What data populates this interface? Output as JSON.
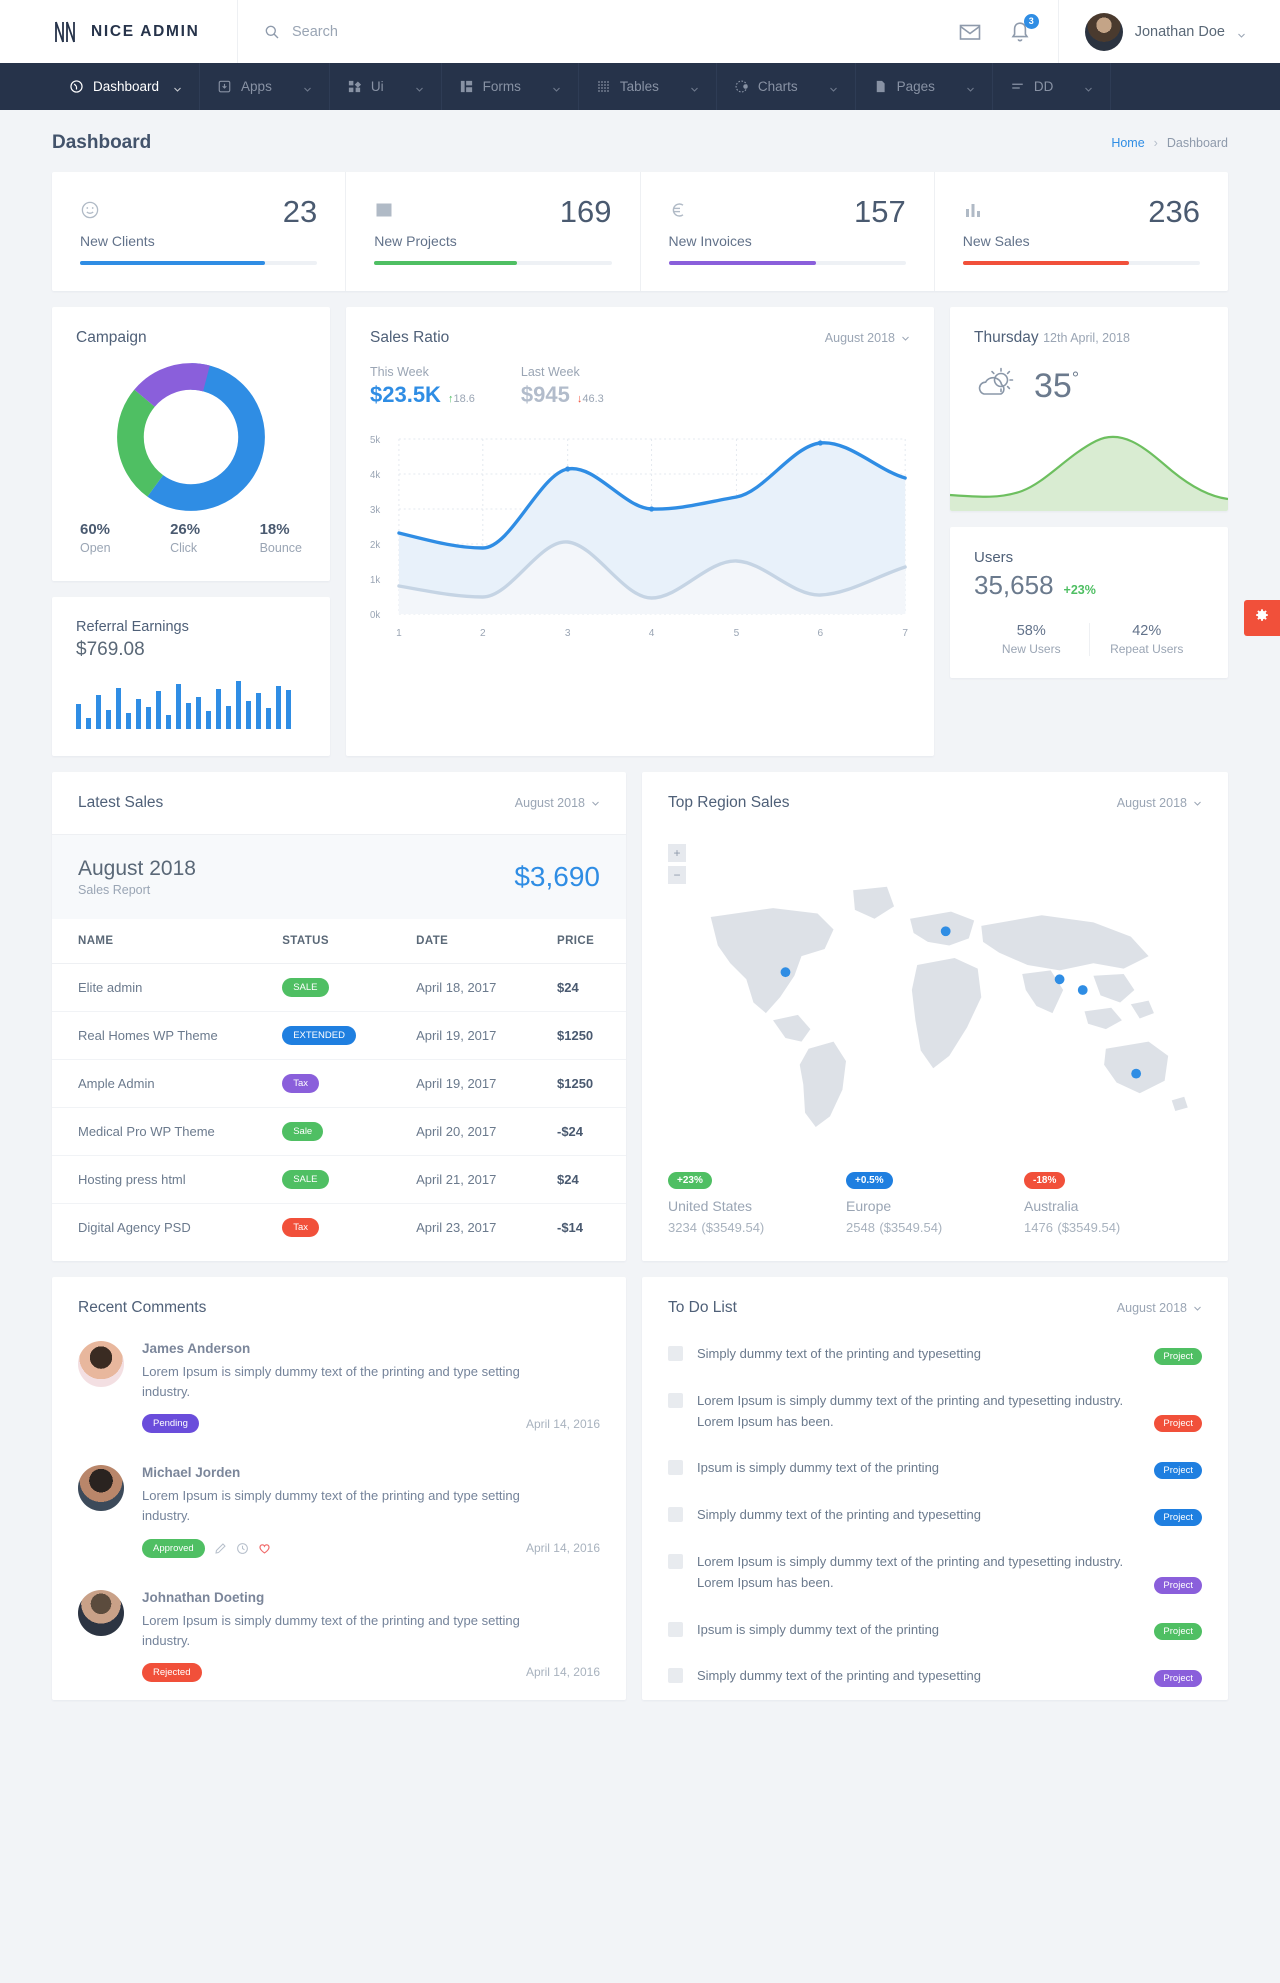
{
  "brand": {
    "name": "NICE ADMIN",
    "icon": "brand-n-icon"
  },
  "search": {
    "placeholder": "Search",
    "value": ""
  },
  "topbar": {
    "mail_icon": "envelope-icon",
    "bell_icon": "bell-icon",
    "notification_count": "3",
    "user_name": "Jonathan Doe"
  },
  "nav": [
    {
      "label": "Dashboard",
      "icon": "speedometer-icon",
      "active": true
    },
    {
      "label": "Apps",
      "icon": "app-box-icon",
      "active": false
    },
    {
      "label": "Ui",
      "icon": "grid-blocks-icon",
      "active": false
    },
    {
      "label": "Forms",
      "icon": "form-columns-icon",
      "active": false
    },
    {
      "label": "Tables",
      "icon": "table-dots-icon",
      "active": false
    },
    {
      "label": "Charts",
      "icon": "target-icon",
      "active": false
    },
    {
      "label": "Pages",
      "icon": "page-icon",
      "active": false
    },
    {
      "label": "DD",
      "icon": "menu-lines-icon",
      "active": false
    }
  ],
  "page": {
    "title": "Dashboard",
    "breadcrumb_home": "Home",
    "breadcrumb_sep": "›",
    "breadcrumb_current": "Dashboard"
  },
  "stats": [
    {
      "label": "New Clients",
      "value": "23",
      "icon": "smiley-icon",
      "color": "#2f8de4",
      "fill": 78
    },
    {
      "label": "New Projects",
      "value": "169",
      "icon": "image-icon",
      "color": "#4fbf63",
      "fill": 60
    },
    {
      "label": "New Invoices",
      "value": "157",
      "icon": "euro-icon",
      "color": "#8a5fdb",
      "fill": 62
    },
    {
      "label": "New Sales",
      "value": "236",
      "icon": "bar-chart-icon",
      "color": "#f1503a",
      "fill": 70
    }
  ],
  "campaign": {
    "title": "Campaign",
    "metrics": [
      {
        "value": "60%",
        "label": "Open",
        "color": "#2f8de4"
      },
      {
        "value": "26%",
        "label": "Click",
        "color": "#4fbf63"
      },
      {
        "value": "18%",
        "label": "Bounce",
        "color": "#8a5fdb"
      }
    ]
  },
  "referral": {
    "title": "Referral Earnings",
    "amount": "$769.08"
  },
  "sales_ratio": {
    "title": "Sales Ratio",
    "period": "August 2018",
    "this_week_label": "This Week",
    "this_week_value": "$23.5K",
    "this_week_delta": "18.6",
    "this_week_dir": "↑",
    "last_week_label": "Last Week",
    "last_week_value": "$945",
    "last_week_delta": "46.3",
    "last_week_dir": "↓"
  },
  "weather": {
    "day": "Thursday",
    "date": "12th April, 2018",
    "temperature": "35",
    "degree_symbol": "°",
    "icon": "sun-cloud-icon"
  },
  "users": {
    "title": "Users",
    "count": "35,658",
    "change": "+23%",
    "new_users_value": "58%",
    "new_users_label": "New Users",
    "repeat_users_value": "42%",
    "repeat_users_label": "Repeat Users"
  },
  "latest_sales": {
    "title": "Latest Sales",
    "period": "August 2018",
    "month": "August 2018",
    "subtitle": "Sales Report",
    "total": "$3,690",
    "columns": [
      "NAME",
      "STATUS",
      "DATE",
      "PRICE"
    ],
    "rows": [
      {
        "name": "Elite admin",
        "status": "SALE",
        "status_color": "#4fbf63",
        "date": "April 18, 2017",
        "price": "$24"
      },
      {
        "name": "Real Homes WP Theme",
        "status": "EXTENDED",
        "status_color": "#1f7fe0",
        "date": "April 19, 2017",
        "price": "$1250"
      },
      {
        "name": "Ample Admin",
        "status": "Tax",
        "status_color": "#8a5fdb",
        "date": "April 19, 2017",
        "price": "$1250"
      },
      {
        "name": "Medical Pro WP Theme",
        "status": "Sale",
        "status_color": "#4fbf63",
        "date": "April 20, 2017",
        "price": "-$24"
      },
      {
        "name": "Hosting press html",
        "status": "SALE",
        "status_color": "#4fbf63",
        "date": "April 21, 2017",
        "price": "$24"
      },
      {
        "name": "Digital Agency PSD",
        "status": "Tax",
        "status_color": "#f1503a",
        "date": "April 23, 2017",
        "price": "-$14"
      }
    ]
  },
  "top_region": {
    "title": "Top Region Sales",
    "period": "August 2018",
    "zoom_in": "+",
    "zoom_out": "−",
    "regions": [
      {
        "badge": "+23%",
        "badge_color": "#4fbf63",
        "name": "United States",
        "value": "3234",
        "amount": "($3549.54)"
      },
      {
        "badge": "+0.5%",
        "badge_color": "#1f7fe0",
        "name": "Europe",
        "value": "2548",
        "amount": "($3549.54)"
      },
      {
        "badge": "-18%",
        "badge_color": "#f1503a",
        "name": "Australia",
        "value": "1476",
        "amount": "($3549.54)"
      }
    ]
  },
  "recent_comments": {
    "title": "Recent Comments",
    "items": [
      {
        "name": "James Anderson",
        "text": "Lorem Ipsum is simply dummy text of the printing and type setting industry.",
        "status": "Pending",
        "status_color": "#6a4ddb",
        "date": "April 14, 2016",
        "has_actions": false
      },
      {
        "name": "Michael Jorden",
        "text": "Lorem Ipsum is simply dummy text of the printing and type setting industry.",
        "status": "Approved",
        "status_color": "#4fbf63",
        "date": "April 14, 2016",
        "has_actions": true
      },
      {
        "name": "Johnathan Doeting",
        "text": "Lorem Ipsum is simply dummy text of the printing and type setting industry.",
        "status": "Rejected",
        "status_color": "#f1503a",
        "date": "April 14, 2016",
        "has_actions": false
      }
    ]
  },
  "todo": {
    "title": "To Do List",
    "period": "August 2018",
    "items": [
      {
        "text": "Simply dummy text of the printing and typesetting",
        "tag": "Project",
        "tag_color": "#4fbf63"
      },
      {
        "text": "Lorem Ipsum is simply dummy text of the printing and typesetting industry. Lorem Ipsum has been.",
        "tag": "Project",
        "tag_color": "#f1503a"
      },
      {
        "text": "Ipsum is simply dummy text of the printing",
        "tag": "Project",
        "tag_color": "#1f7fe0"
      },
      {
        "text": "Simply dummy text of the printing and typesetting",
        "tag": "Project",
        "tag_color": "#1f7fe0"
      },
      {
        "text": "Lorem Ipsum is simply dummy text of the printing and typesetting industry. Lorem Ipsum has been.",
        "tag": "Project",
        "tag_color": "#8a5fdb"
      },
      {
        "text": "Ipsum is simply dummy text of the printing",
        "tag": "Project",
        "tag_color": "#4fbf63"
      },
      {
        "text": "Simply dummy text of the printing and typesetting",
        "tag": "Project",
        "tag_color": "#8a5fdb"
      }
    ]
  },
  "settings_tab": {
    "icon": "gear-icon"
  },
  "chart_data": [
    {
      "id": "sales-ratio-chart",
      "type": "area",
      "title": "Sales Ratio",
      "x": [
        1,
        2,
        3,
        4,
        5,
        6,
        7
      ],
      "xlabel": "",
      "ylabel": "",
      "ylim": [
        0,
        5000
      ],
      "ytick_labels": [
        "0k",
        "1k",
        "2k",
        "3k",
        "4k",
        "5k"
      ],
      "grid": true,
      "legend": "none",
      "series": [
        {
          "name": "This Week",
          "color": "#2f8de4",
          "values": [
            2300,
            1900,
            4150,
            3050,
            3350,
            4800,
            3900
          ]
        },
        {
          "name": "Last Week",
          "color": "#c5d4e4",
          "values": [
            800,
            500,
            2050,
            450,
            1500,
            550,
            1350
          ]
        }
      ]
    },
    {
      "id": "campaign-donut",
      "type": "pie",
      "title": "Campaign",
      "categories": [
        "Open",
        "Click",
        "Bounce"
      ],
      "values": [
        60,
        26,
        18
      ],
      "colors": [
        "#2f8de4",
        "#4fbf63",
        "#8a5fdb"
      ]
    },
    {
      "id": "weather-area-chart",
      "type": "area",
      "title": "",
      "x": [
        1,
        2,
        3,
        4,
        5,
        6,
        7,
        8
      ],
      "values": [
        18,
        16,
        22,
        30,
        58,
        72,
        48,
        30
      ],
      "color": "#6dbf5f",
      "ylim": [
        0,
        100
      ],
      "grid": false
    },
    {
      "id": "referral-earnings-bars",
      "type": "bar",
      "title": "Referral Earnings",
      "categories": [
        "1",
        "2",
        "3",
        "4",
        "5",
        "6",
        "7",
        "8",
        "9",
        "10",
        "11",
        "12",
        "13",
        "14",
        "15",
        "16",
        "17",
        "18",
        "19",
        "20",
        "21",
        "22"
      ],
      "values": [
        38,
        20,
        52,
        30,
        64,
        26,
        46,
        34,
        58,
        22,
        70,
        40,
        50,
        28,
        62,
        36,
        74,
        44,
        56,
        32,
        68,
        60
      ],
      "color": "#2f8de4",
      "ylim": [
        0,
        80
      ],
      "grid": false
    }
  ]
}
